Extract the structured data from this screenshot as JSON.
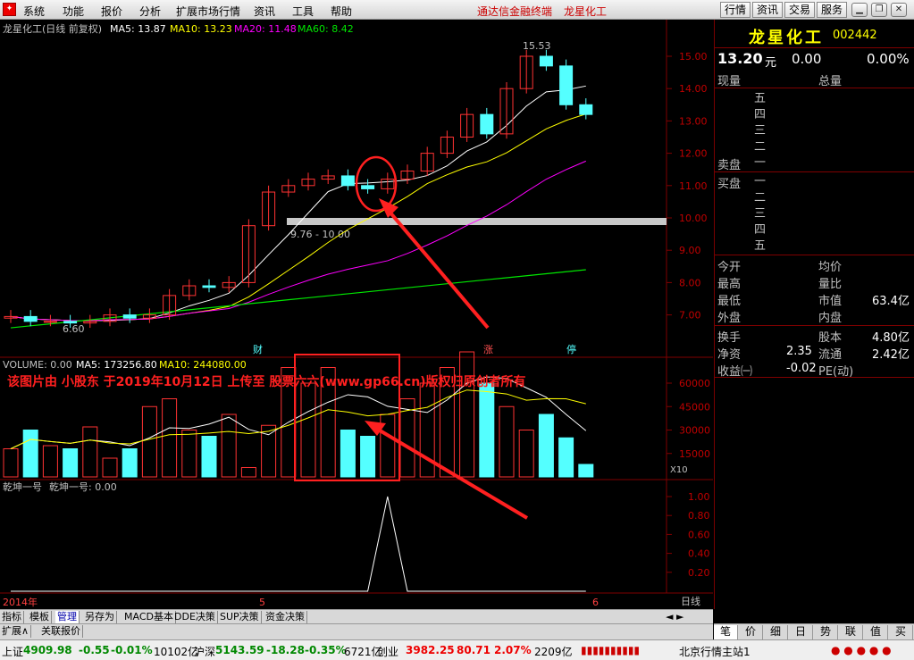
{
  "menu": {
    "items": [
      "系统",
      "功能",
      "报价",
      "分析",
      "扩展市场行情",
      "资讯",
      "工具",
      "帮助"
    ],
    "vendor": "通达信金融终端",
    "vendor_stock": "龙星化工",
    "right_buttons": [
      "行情",
      "资讯",
      "交易",
      "服务"
    ]
  },
  "chart": {
    "title": "龙星化工(日线 前复权)",
    "ma5": "MA5: 13.87",
    "ma10": "MA10: 13.23",
    "ma20": "MA20: 11.48",
    "ma60": "MA60: 8.42",
    "price_ticks": [
      "15.00",
      "14.00",
      "13.00",
      "12.00",
      "11.00",
      "10.00",
      "9.00",
      "8.00",
      "7.00"
    ],
    "high_label": "15.53",
    "low_label": "6.60",
    "range_label": "9.76 - 10.00",
    "markers": [
      "财",
      "涨",
      "停"
    ],
    "volume_header": {
      "vol": "VOLUME: 0.00",
      "ma5": "MA5: 173256.80",
      "ma10": "MA10: 244080.00"
    },
    "watermark": "该图片由 小股东 于2019年10月12日 上传至 股票六六(www.gp66.cn)版权归原创者所有",
    "vol_ticks": [
      "60000",
      "45000",
      "30000",
      "15000"
    ],
    "vol_unit": "X10",
    "ind_header": {
      "name": "乾坤一号",
      "value": "乾坤一号: 0.00"
    },
    "ind_ticks": [
      "1.00",
      "0.80",
      "0.60",
      "0.40",
      "0.20"
    ],
    "date_labels": [
      "2014年",
      "5",
      "6"
    ],
    "period": "日线"
  },
  "chart_data": {
    "type": "candlestick",
    "title": "龙星化工(日线 前复权)",
    "close_values": [
      6.95,
      6.8,
      6.8,
      6.75,
      6.8,
      7.0,
      6.9,
      7.0,
      7.6,
      7.9,
      7.85,
      8.0,
      9.76,
      10.8,
      11.0,
      11.2,
      11.3,
      11.0,
      10.9,
      11.2,
      11.45,
      12.0,
      12.5,
      13.2,
      12.6,
      14.0,
      15.0,
      14.7,
      13.5,
      13.2
    ],
    "volume": [
      18000,
      30000,
      20000,
      18000,
      32000,
      12000,
      18000,
      45000,
      50000,
      30000,
      26000,
      40000,
      6000,
      33000,
      70000,
      60000,
      70000,
      30000,
      26000,
      40000,
      50000,
      60000,
      70000,
      80000,
      60000,
      45000,
      30000,
      40000,
      25000,
      8000
    ],
    "indicator": [
      0,
      0,
      0,
      0,
      0,
      0,
      0,
      0,
      0,
      0,
      0,
      0,
      0,
      0,
      0,
      0,
      0,
      0,
      0,
      1,
      0,
      0,
      0,
      0,
      0,
      0,
      0,
      0,
      0,
      0
    ]
  },
  "quote": {
    "name": "龙星化工",
    "code": "002442",
    "price": "13.20",
    "price_unit": "元",
    "change": "0.00",
    "change_pct": "0.00%",
    "cur_vol": "现量",
    "total_vol": "总量",
    "sell_levels": [
      "五",
      "四",
      "三",
      "二",
      "一"
    ],
    "buy_levels": [
      "一",
      "二",
      "三",
      "四",
      "五"
    ],
    "sell_label": "卖盘",
    "buy_label": "买盘",
    "stats": [
      [
        "今开",
        "",
        "均价",
        ""
      ],
      [
        "最高",
        "",
        "量比",
        ""
      ],
      [
        "最低",
        "",
        "市值",
        "63.4亿"
      ],
      [
        "外盘",
        "",
        "内盘",
        ""
      ]
    ],
    "stats2": [
      [
        "换手",
        "",
        "股本",
        "4.80亿"
      ],
      [
        "净资",
        "2.35",
        "流通",
        "2.42亿"
      ],
      [
        "收益㈠",
        "-0.02",
        "PE(动)",
        ""
      ]
    ]
  },
  "tabs": [
    "指标",
    "模板",
    "管理",
    "另存为",
    "MACD基本",
    "DDE决策",
    "SUP决策",
    "资金决策"
  ],
  "ext": [
    "扩展∧",
    "关联报价"
  ],
  "right_tabs": [
    "笔",
    "价",
    "细",
    "日",
    "势",
    "联",
    "值",
    "买"
  ],
  "status": {
    "sh_label": "上证",
    "sh_val": "4909.98",
    "sh_chg": "-0.55",
    "sh_pct": "-0.01%",
    "sh_amt": "10102亿",
    "sz_label": "沪深",
    "sz_val": "5143.59",
    "sz_chg": "-18.28",
    "sz_pct": "-0.35%",
    "sz_amt": "6721亿",
    "cy_label": "创业",
    "cy_val": "3982.25",
    "cy_chg": "80.71",
    "cy_pct": "2.07%",
    "cy_amt": "2209亿",
    "server": "北京行情主站1"
  },
  "colors": {
    "up": "#ff3232",
    "down": "#54ffff",
    "ma5": "#ffffff",
    "ma10": "#ffff00",
    "ma20": "#ff00ff",
    "ma60": "#00e600",
    "grid": "#800000"
  }
}
